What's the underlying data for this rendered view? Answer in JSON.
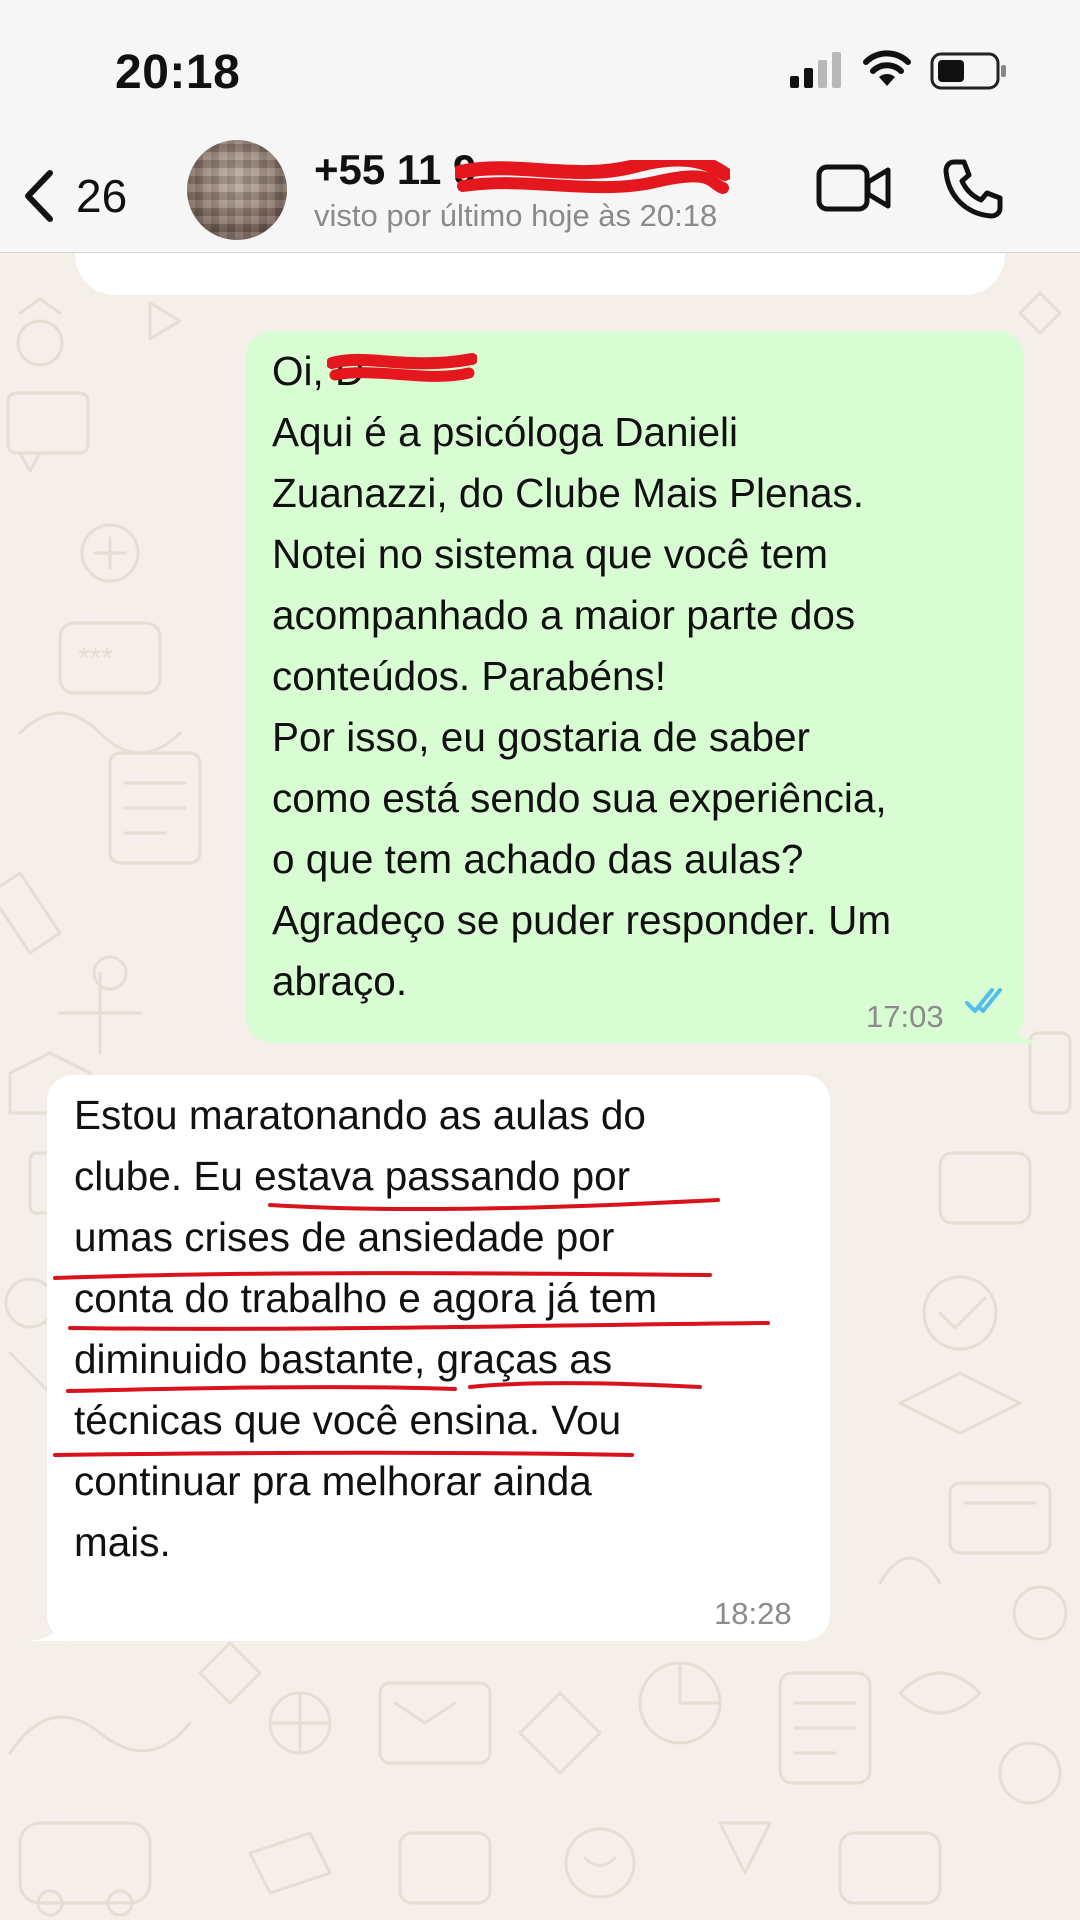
{
  "status_bar": {
    "time": "20:18"
  },
  "header": {
    "back_count": "26",
    "contact_name": "+55 11 9",
    "contact_status": "visto por último hoje às 20:18"
  },
  "messages": {
    "outgoing": {
      "lines": [
        "Oi, D",
        "Aqui é a psicóloga Danieli",
        "Zuanazzi, do Clube Mais Plenas.",
        "Notei no sistema que você tem",
        "acompanhado a maior parte dos",
        "conteúdos. Parabéns!",
        "Por isso, eu gostaria de saber",
        "como está sendo sua experiência,",
        "o que tem achado das aulas?",
        "Agradeço se puder responder. Um",
        "abraço."
      ],
      "time": "17:03"
    },
    "incoming": {
      "lines": [
        "Estou maratonando as aulas do",
        "clube. Eu estava passando por",
        "umas crises de ansiedade por",
        "conta do trabalho e agora já tem",
        "diminuido bastante, graças as",
        "técnicas que você ensina. Vou",
        "continuar pra melhorar ainda",
        "mais."
      ],
      "time": "18:28"
    }
  },
  "colors": {
    "outgoing_bubble": "#d9fdd3",
    "incoming_bubble": "#ffffff",
    "chat_background": "#f4efe9",
    "read_receipt": "#53bdeb",
    "annotation_red": "#d9131b"
  },
  "icons": {
    "signal": "signal-icon",
    "wifi": "wifi-icon",
    "battery": "battery-icon",
    "back": "chevron-left-icon",
    "video": "video-camera-icon",
    "phone": "phone-icon",
    "read": "double-check-icon"
  }
}
